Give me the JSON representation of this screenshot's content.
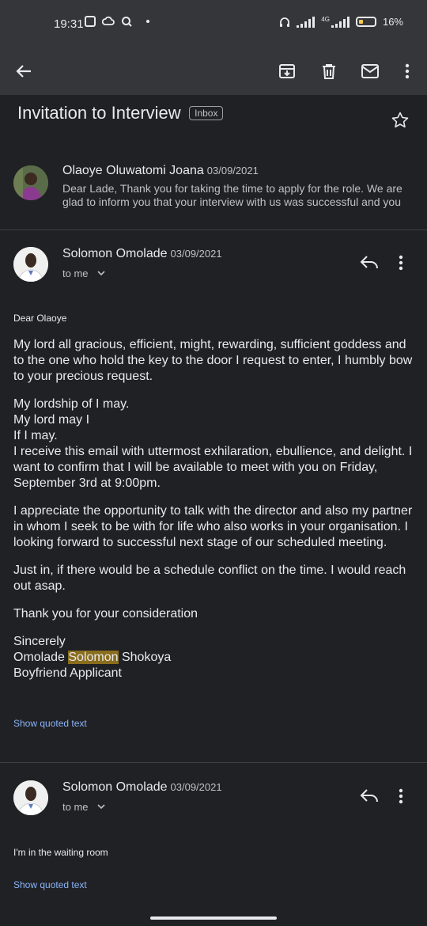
{
  "status": {
    "time": "19:31",
    "network_label": "4G",
    "battery": "16%"
  },
  "toolbar": {
    "icons": [
      "back-arrow-icon",
      "archive-icon",
      "delete-icon",
      "mark-unread-icon",
      "more-vert-icon"
    ]
  },
  "subject": {
    "title": "Invitation to Interview",
    "label": "Inbox"
  },
  "messages": [
    {
      "sender": "Olaoye Oluwatomi Joana",
      "date": "03/09/2021",
      "snippet_line1": "Dear Lade, Thank you for taking the time to apply for the role. We are",
      "snippet_line2": "glad to inform you that your interview with us was successful and you"
    },
    {
      "sender": "Solomon Omolade",
      "date": "03/09/2021",
      "to": "to me",
      "greeting": "Dear Olaoye",
      "p1": "My lord all gracious, efficient, might, rewarding, sufficient goddess and to the one who hold the key to the door I request to enter, I humbly bow to your precious request.",
      "p2_line1": "My lordship of I may.",
      "p2_line2": "My lord may I",
      "p2_line3": "If I may.",
      "p2_line4": "I receive this email with uttermost exhilaration, ebullience, and delight. I want to confirm that I will be available to meet with you on Friday,  September 3rd at 9:00pm.",
      "p3": "I appreciate the opportunity to talk with the director and also my partner in whom I seek to be with for life who also works in your organisation. I looking forward to successful next stage of our scheduled meeting.",
      "p4": "Just in, if there would be a schedule conflict on the time. I would reach out asap.",
      "p5": "Thank you for your consideration",
      "sign_line1": "Sincerely",
      "sign_first": "Omolade",
      "sign_highlight": "Solomon",
      "sign_last": "Shokoya",
      "sign_line3": "Boyfriend Applicant",
      "quoted": "Show quoted text"
    },
    {
      "sender": "Solomon Omolade",
      "date": "03/09/2021",
      "to": "to me",
      "body": "I'm in the waiting room",
      "quoted": "Show quoted text"
    }
  ],
  "colors": {
    "background": "#202124",
    "bar": "#34363a",
    "link": "#8ab4f8",
    "highlight": "#8a6d1d"
  }
}
